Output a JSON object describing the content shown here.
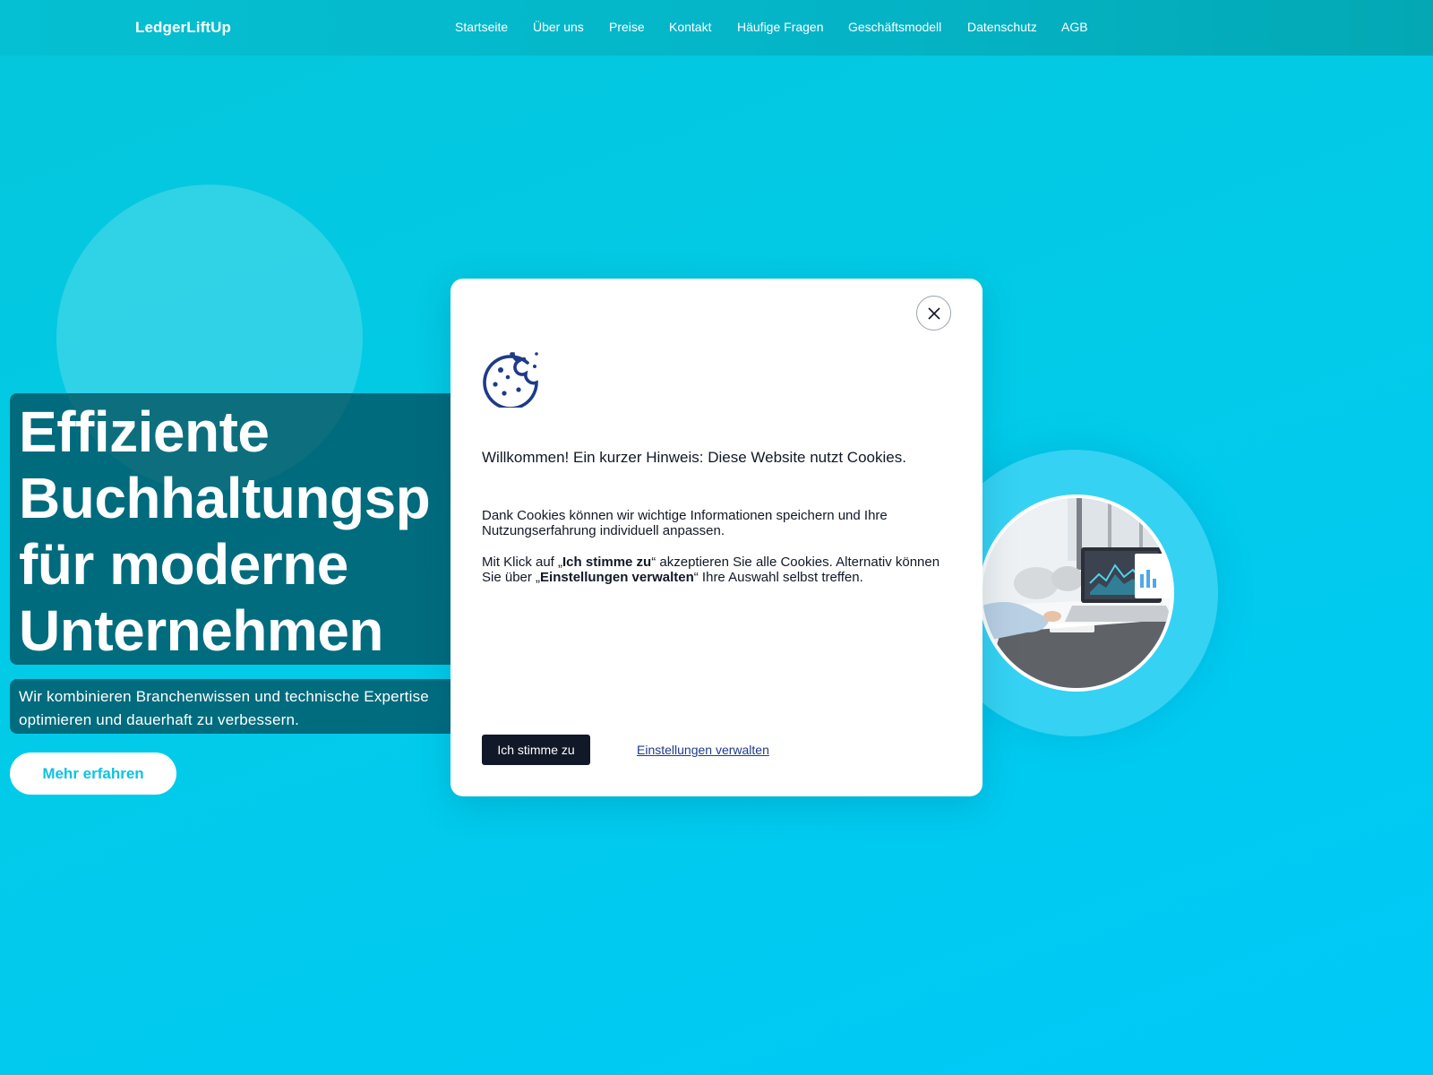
{
  "header": {
    "brand": "LedgerLiftUp",
    "nav": [
      {
        "label": "Startseite"
      },
      {
        "label": "Über uns"
      },
      {
        "label": "Preise"
      },
      {
        "label": "Kontakt"
      },
      {
        "label": "Häufige Fragen"
      },
      {
        "label": "Geschäftsmodell"
      },
      {
        "label": "Datenschutz"
      },
      {
        "label": "AGB"
      }
    ]
  },
  "hero": {
    "title_lines": [
      "Effiziente",
      "Buchhaltungsp",
      "für moderne",
      "Unternehmen"
    ],
    "subtitle_lines": [
      "Wir kombinieren Branchenwissen und technische Expertise",
      "optimieren und dauerhaft zu verbessern."
    ],
    "cta_label": "Mehr erfahren"
  },
  "cookie_dialog": {
    "title": "Willkommen! Ein kurzer Hinweis: Diese Website nutzt Cookies.",
    "paragraph1": "Dank Cookies können wir wichtige Informationen speichern und Ihre Nutzungserfahrung individuell anpassen.",
    "paragraph2": {
      "part1": "Mit Klick auf „",
      "accept_ref": "Ich stimme zu",
      "part2": "“ akzeptieren Sie alle Cookies. Alternativ können Sie über „",
      "manage_ref": "Einstellungen verwalten",
      "part3": "“ Ihre Auswahl selbst treffen."
    },
    "accept_label": "Ich stimme zu",
    "manage_label": "Einstellungen verwalten"
  },
  "icons": {
    "cookie": "cookie-icon",
    "close": "close-icon"
  },
  "colors": {
    "background": "#02cbe8",
    "cta_text": "#0ec3e0",
    "dark_button": "#111827",
    "cookie_icon": "#1e3a8a",
    "link": "#1e3a8a"
  }
}
